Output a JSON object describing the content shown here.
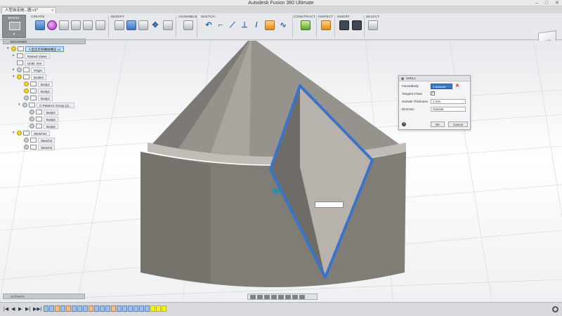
{
  "app": {
    "title": "Autodesk Fusion 360 Ultimate",
    "min": "–",
    "max": "□",
    "close": "✕"
  },
  "doc_tab": {
    "label": "人型自走砲...圖 v1*",
    "close": "x"
  },
  "workspace": {
    "label": "MODEL",
    "dropdown": "▾"
  },
  "toolbar_groups": {
    "create": "CREATE",
    "modify": "MODIFY",
    "assemble": "ASSEMBLE",
    "sketch": "SKETCH",
    "construct": "CONSTRUCT",
    "inspect": "INSPECT",
    "insert": "INSERT",
    "select": "SELECT"
  },
  "viewcube": {
    "label": "SIDE"
  },
  "browser": {
    "header": "BROWSER",
    "items": [
      {
        "label": "人型自走砲機械構造 v1",
        "selected": true
      },
      {
        "label": "Named Views"
      },
      {
        "label": "Units: mm"
      },
      {
        "label": "Origin"
      },
      {
        "label": "Bodies"
      },
      {
        "label": "Body1"
      },
      {
        "label": "Body2"
      },
      {
        "label": "Body3"
      },
      {
        "label": "C-Pattern1 Group (1)..."
      },
      {
        "label": "Body4"
      },
      {
        "label": "Body5"
      },
      {
        "label": "Body6"
      },
      {
        "label": "Sketches"
      },
      {
        "label": "Sketch2"
      },
      {
        "label": "Sketch3"
      }
    ]
  },
  "shell_dialog": {
    "title": "SHELL",
    "faces_label": "Faces/Body",
    "faces_value": "1 selected",
    "clear_icon": "✕",
    "tangent_label": "Tangent Chain",
    "tangent_checked": "✓",
    "thickness_label": "Outside Thickness",
    "thickness_value": "1 mm",
    "direction_label": "Direction",
    "direction_value": "Outside",
    "help": "?",
    "ok": "OK",
    "cancel": "Cancel"
  },
  "activity": {
    "label": "ACTIVITY"
  },
  "timeline": {
    "controls": [
      "|◀",
      "◀",
      "▶",
      "▶|",
      "▶▶|"
    ]
  },
  "colors": {
    "body": "#8a8680",
    "selection": "#3a74c9",
    "accent": "#3d78c9"
  }
}
